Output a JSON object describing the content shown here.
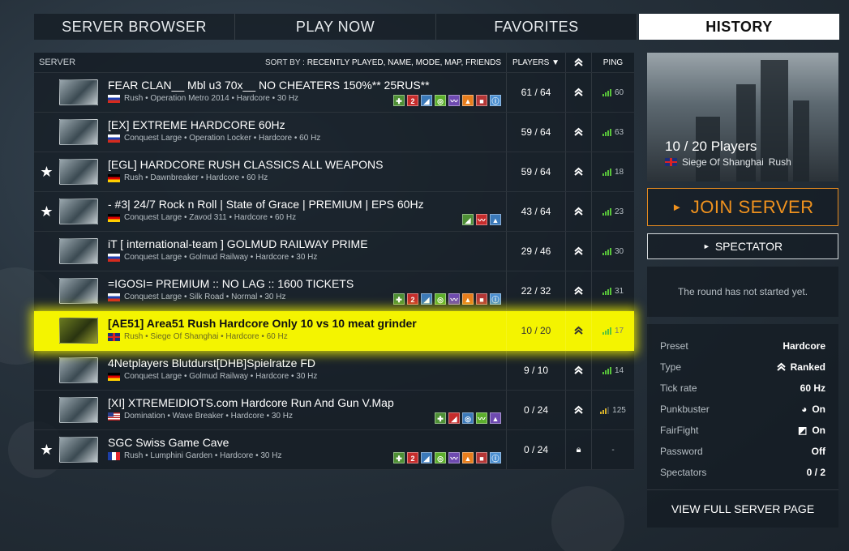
{
  "tabs": [
    {
      "label": "SERVER BROWSER"
    },
    {
      "label": "PLAY NOW"
    },
    {
      "label": "FAVORITES"
    },
    {
      "label": "HISTORY"
    }
  ],
  "list_header": {
    "server": "SERVER",
    "sort_prefix": "SORT BY :",
    "sort_options": "RECENTLY PLAYED, NAME, MODE, MAP, FRIENDS",
    "players": "PLAYERS ▼",
    "ping": "PING"
  },
  "servers": [
    {
      "favorite": "",
      "name": "FEAR CLAN__ Mbl u3 70x__ NO CHEATERS 150%** 25RUS**",
      "sub": "Rush • Operation Metro 2014 • Hardcore • 30 Hz",
      "flag": "ru",
      "players": "61 / 64",
      "ping": "60",
      "badges": [
        "✚",
        "2",
        "◢",
        "◎",
        "〰",
        "▲",
        "■",
        "ⓘ"
      ]
    },
    {
      "favorite": "",
      "name": "[EX] EXTREME HARDCORE 60Hz",
      "sub": "Conquest Large • Operation Locker • Hardcore • 60 Hz",
      "flag": "ru",
      "players": "59 / 64",
      "ping": "63",
      "badges": []
    },
    {
      "favorite": "★",
      "name": "[EGL] HARDCORE RUSH CLASSICS ALL WEAPONS",
      "sub": "Rush • Dawnbreaker • Hardcore • 60 Hz",
      "flag": "de",
      "players": "59 / 64",
      "ping": "18",
      "badges": []
    },
    {
      "favorite": "★",
      "name": "- #3| 24/7 Rock n Roll | State of Grace | PREMIUM | EPS 60Hz",
      "sub": "Conquest Large • Zavod 311 • Hardcore • 60 Hz",
      "flag": "de",
      "players": "43 / 64",
      "ping": "23",
      "badges": [
        "◢",
        "〰",
        "▲"
      ]
    },
    {
      "favorite": "",
      "name": "iT [ international-team ] GOLMUD RAILWAY PRIME",
      "sub": "Conquest Large • Golmud Railway • Hardcore • 30 Hz",
      "flag": "ru",
      "players": "29 / 46",
      "ping": "30",
      "badges": []
    },
    {
      "favorite": "",
      "name": "=IGOSI= PREMIUM :: NO LAG :: 1600 TICKETS",
      "sub": "Conquest Large • Silk Road • Normal • 30 Hz",
      "flag": "ru",
      "players": "22 / 32",
      "ping": "31",
      "badges": [
        "✚",
        "2",
        "◢",
        "◎",
        "〰",
        "▲",
        "■",
        "ⓘ"
      ]
    },
    {
      "favorite": "",
      "name": "[AE51] Area51 Rush Hardcore Only 10 vs 10 meat grinder",
      "sub": "Rush • Siege Of Shanghai • Hardcore • 60 Hz",
      "flag": "uk",
      "players": "10 / 20",
      "ping": "17",
      "badges": [],
      "highlight": true
    },
    {
      "favorite": "",
      "name": "4Netplayers Blutdurst[DHB]Spielratze FD",
      "sub": "Conquest Large • Golmud Railway • Hardcore • 30 Hz",
      "flag": "de",
      "players": "9 / 10",
      "ping": "14",
      "badges": []
    },
    {
      "favorite": "",
      "name": "[XI] XTREMEIDIOTS.com Hardcore Run And Gun V.Map",
      "sub": "Domination • Wave Breaker • Hardcore • 30 Hz",
      "flag": "us",
      "players": "0 / 24",
      "ping": "125",
      "badges": [
        "✚",
        "◢",
        "◎",
        "〰",
        "▲"
      ]
    },
    {
      "favorite": "★",
      "name": "SGC Swiss Game Cave",
      "sub": "Rush • Lumphini Garden • Hardcore • 30 Hz",
      "flag": "fr",
      "players": "0 / 24",
      "ping": "-",
      "badges": [
        "✚",
        "2",
        "◢",
        "◎",
        "〰",
        "▲",
        "■",
        "ⓘ"
      ],
      "locked": true
    }
  ],
  "panel": {
    "player_count": "10 / 20 Players",
    "map": "Siege Of Shanghai",
    "mode": "Rush",
    "join_label": "JOIN SERVER",
    "spectator_label": "SPECTATOR",
    "status_text": "The round has not started yet.",
    "details": [
      {
        "key": "Preset",
        "value": "Hardcore"
      },
      {
        "key": "Type",
        "value": "Ranked"
      },
      {
        "key": "Tick rate",
        "value": "60 Hz"
      },
      {
        "key": "Punkbuster",
        "value": "On"
      },
      {
        "key": "FairFight",
        "value": "On"
      },
      {
        "key": "Password",
        "value": "Off"
      },
      {
        "key": "Spectators",
        "value": "0 / 2"
      }
    ],
    "view_full_label": "VIEW FULL SERVER PAGE"
  },
  "colors": {
    "accent": "#f0921e",
    "highlight": "#f4f400",
    "ping_good": "#58c43a",
    "ping_warn": "#d6b12a"
  }
}
